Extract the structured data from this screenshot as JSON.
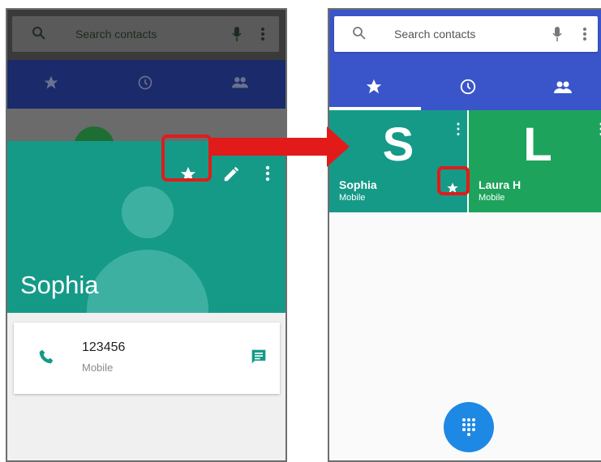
{
  "left_screen": {
    "search_placeholder": "Search contacts",
    "tabs": [
      "star-icon",
      "clock-icon",
      "people-icon"
    ],
    "contact_name": "Sophia",
    "phone_number": "123456",
    "phone_type": "Mobile",
    "header_color": "#159a88"
  },
  "right_screen": {
    "search_placeholder": "Search contacts",
    "tabs": [
      "star-icon",
      "clock-icon",
      "people-icon"
    ],
    "favorites": [
      {
        "initial": "S",
        "name": "Sophia",
        "type": "Mobile",
        "color": "#159a88"
      },
      {
        "initial": "L",
        "name": "Laura H",
        "type": "Mobile",
        "color": "#1ea35c"
      }
    ],
    "accent": "#3a55c9"
  },
  "annotation_color": "#e31a1a"
}
